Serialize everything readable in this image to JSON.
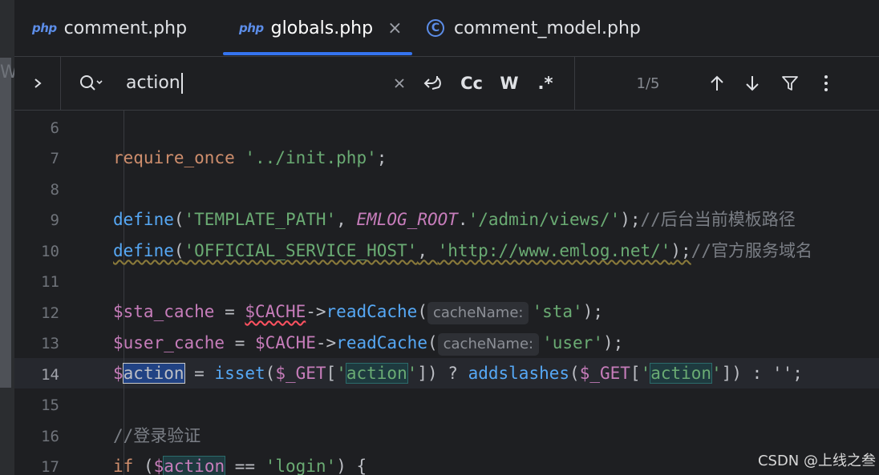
{
  "tabs": [
    {
      "icon": "php",
      "label": "comment.php",
      "active": false
    },
    {
      "icon": "php",
      "label": "globals.php",
      "active": true,
      "close": "×"
    },
    {
      "icon": "C",
      "label": "comment_model.php",
      "active": false
    }
  ],
  "left_strip": {
    "glyph": "W"
  },
  "search": {
    "value": "action",
    "case_label": "Cc",
    "words_label": "W",
    "regex_label": ".*",
    "match_count": "1/5"
  },
  "editor": {
    "line_numbers": [
      "6",
      "7",
      "8",
      "9",
      "10",
      "11",
      "12",
      "13",
      "14",
      "15",
      "16",
      "17"
    ],
    "current_line": "14",
    "lines": {
      "l7": {
        "kw": "require_once",
        "str": "'../init.php'",
        "end": ";"
      },
      "l9": {
        "fn": "define",
        "p1": "(",
        "s1": "'TEMPLATE_PATH'",
        "c": ", ",
        "const": "EMLOG_ROOT",
        "dot": ".",
        "s2": "'/admin/views/'",
        "end": ");",
        "comment": "//后台当前模板路径"
      },
      "l10": {
        "fn": "define",
        "p1": "(",
        "s1": "'OFFICIAL_SERVICE_HOST'",
        "c": ", ",
        "s2": "'http://www.emlog.net/'",
        "end": ");",
        "comment": "//官方服务域名"
      },
      "l12": {
        "var": "$sta_cache",
        "eq": " = ",
        "cache": "$CACHE",
        "arrow": "->",
        "fn": "readCache",
        "p": "(",
        "hint": "cacheName:",
        "str": "'sta'",
        "end": ");"
      },
      "l13": {
        "var": "$user_cache",
        "eq": " = ",
        "cache": "$CACHE",
        "arrow": "->",
        "fn": "readCache",
        "p": "(",
        "hint": "cacheName:",
        "str": "'user'",
        "end": ");"
      },
      "l14": {
        "dollar": "$",
        "name": "action",
        "eq": " = ",
        "fn1": "isset",
        "p1": "(",
        "get1": "$_GET",
        "b1": "[",
        "q": "'",
        "key": "action",
        "b2": "]) ? ",
        "fn2": "addslashes",
        "p2": "(",
        "get2": "$_GET",
        "end": "]) : '';"
      },
      "l16": {
        "comment": "//登录验证"
      },
      "l17": {
        "kw": "if",
        "p": " (",
        "dollar": "$",
        "name": "action",
        "op": " == ",
        "str": "'login'",
        "end": ") {"
      }
    }
  },
  "watermark": "CSDN @上线之叁"
}
